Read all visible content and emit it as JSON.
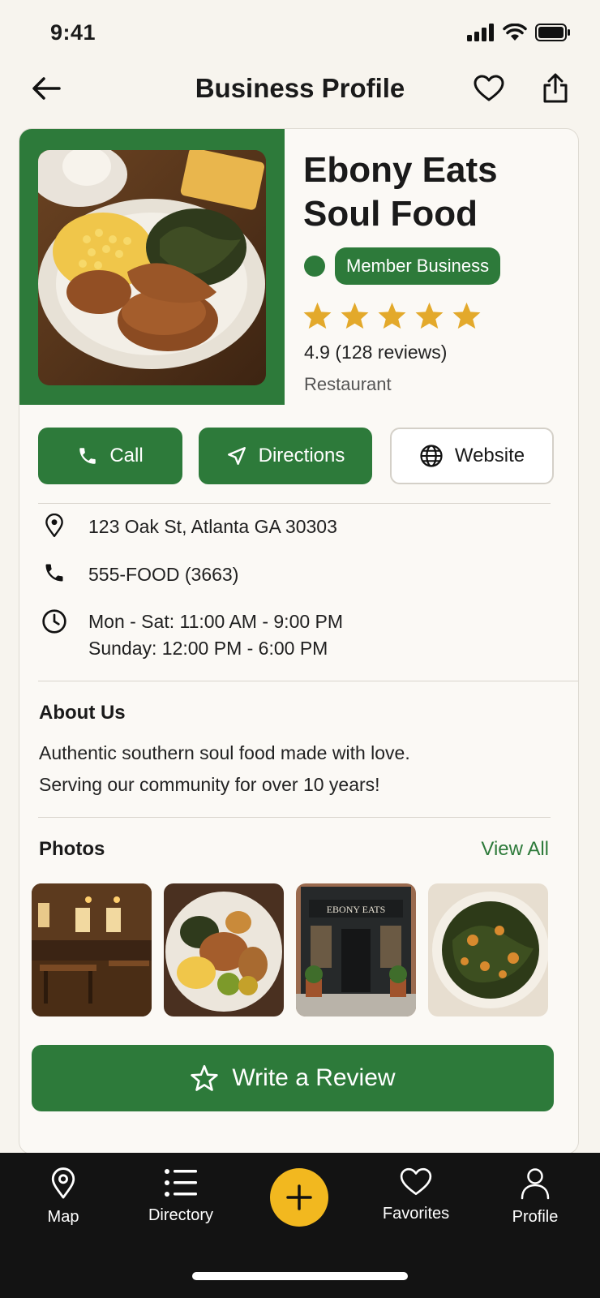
{
  "status_bar": {
    "time": "9:41"
  },
  "header": {
    "title": "Business Profile"
  },
  "business": {
    "name_line1": "Ebony Eats",
    "name_line2": "Soul Food",
    "badge": "Member Business",
    "rating_value": "4.9",
    "review_count": "(128 reviews)",
    "stars": 5,
    "category": "Restaurant"
  },
  "actions": {
    "call": "Call",
    "directions": "Directions",
    "website": "Website"
  },
  "contact": {
    "address": "123 Oak St, Atlanta GA 30303",
    "phone": "555-FOOD (3663)",
    "hours_line1": "Mon - Sat: 11:00 AM - 9:00 PM",
    "hours_line2": "Sunday: 12:00 PM - 6:00 PM"
  },
  "about": {
    "title": "About Us",
    "line1": "Authentic southern soul food made with love.",
    "line2": "Serving our community for over 10 years!"
  },
  "photos": {
    "title": "Photos",
    "view_all": "View All",
    "storefront_sign": "EBONY EATS"
  },
  "review_button": "Write a Review",
  "bottom_nav": {
    "map": "Map",
    "directory": "Directory",
    "favorites": "Favorites",
    "profile": "Profile"
  },
  "colors": {
    "brand_green": "#2d7a3a",
    "star_gold": "#e3a92b",
    "fab_yellow": "#f2b81f",
    "nav_bg": "#131313"
  }
}
